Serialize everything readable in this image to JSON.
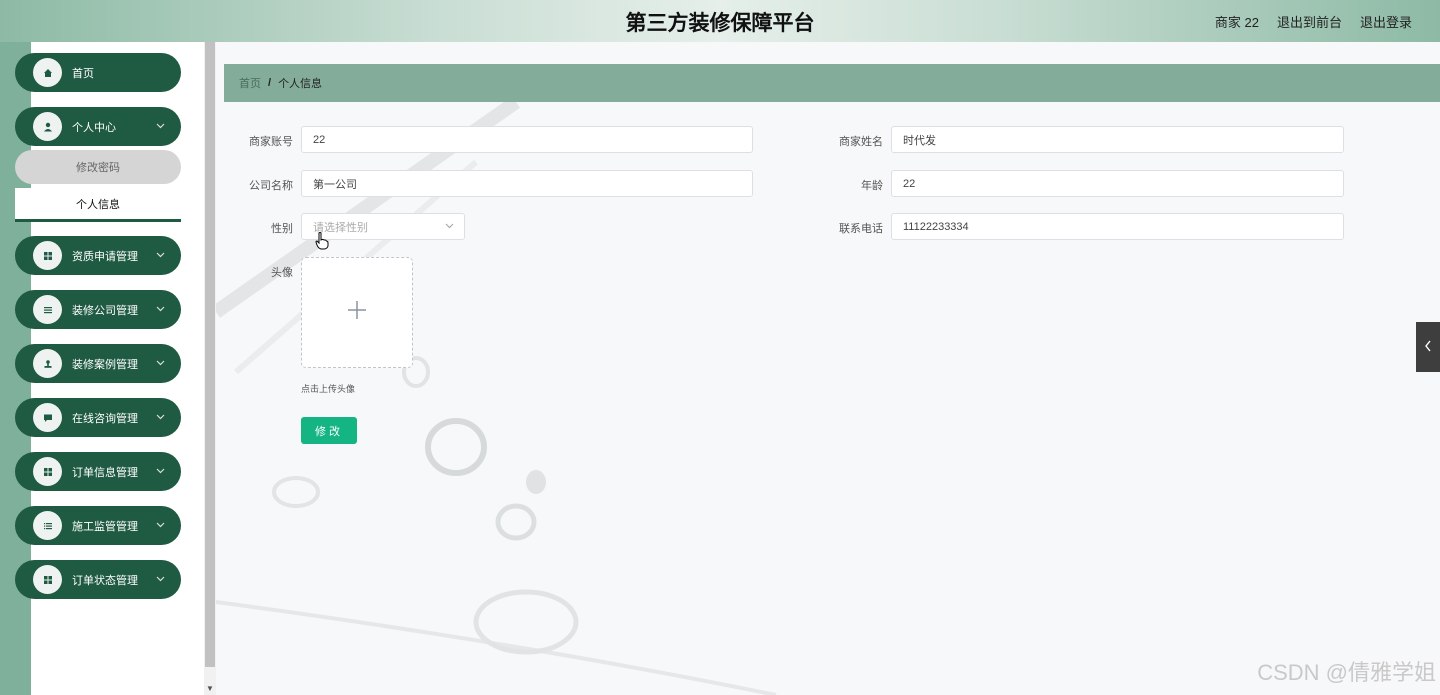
{
  "header": {
    "title": "第三方装修保障平台",
    "user_label": "商家 22",
    "back_front_label": "退出到前台",
    "logout_label": "退出登录"
  },
  "sidebar": {
    "items": [
      {
        "label": "首页",
        "icon": "home-icon"
      },
      {
        "label": "个人中心",
        "icon": "user-icon"
      },
      {
        "label": "资质申请管理",
        "icon": "grid-icon"
      },
      {
        "label": "装修公司管理",
        "icon": "list-icon"
      },
      {
        "label": "装修案例管理",
        "icon": "stamp-icon"
      },
      {
        "label": "在线咨询管理",
        "icon": "chat-icon"
      },
      {
        "label": "订单信息管理",
        "icon": "grid-icon"
      },
      {
        "label": "施工监管管理",
        "icon": "list-icon"
      },
      {
        "label": "订单状态管理",
        "icon": "grid-icon"
      }
    ],
    "subitems": [
      {
        "label": "修改密码"
      },
      {
        "label": "个人信息"
      }
    ]
  },
  "breadcrumb": {
    "home": "首页",
    "separator": "/",
    "current": "个人信息"
  },
  "form": {
    "merchant_account_label": "商家账号",
    "merchant_account_value": "22",
    "merchant_name_label": "商家姓名",
    "merchant_name_value": "时代发",
    "company_label": "公司名称",
    "company_value": "第一公司",
    "age_label": "年龄",
    "age_value": "22",
    "gender_label": "性别",
    "gender_placeholder": "请选择性别",
    "phone_label": "联系电话",
    "phone_value": "11122233334",
    "avatar_label": "头像",
    "upload_hint": "点击上传头像",
    "submit_label": "修改"
  },
  "watermark": "CSDN @倩雅学姐",
  "colors": {
    "menu_bg": "#1f5a43",
    "breadcrumb_bg": "#84ac9a",
    "submit_bg": "#14b483",
    "frame_bg": "#7fb09b"
  }
}
